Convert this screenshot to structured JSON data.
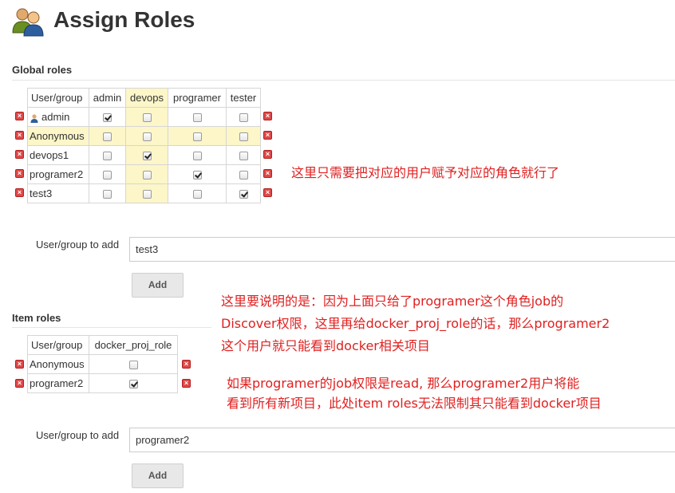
{
  "page": {
    "title": "Assign Roles"
  },
  "global_roles": {
    "header": "Global roles",
    "columns": [
      "User/group",
      "admin",
      "devops",
      "programer",
      "tester"
    ],
    "rows": [
      {
        "name": "admin",
        "has_user_icon": true,
        "checks": [
          true,
          false,
          false,
          false
        ]
      },
      {
        "name": "Anonymous",
        "has_user_icon": false,
        "checks": [
          false,
          false,
          false,
          false
        ]
      },
      {
        "name": "devops1",
        "has_user_icon": false,
        "checks": [
          false,
          true,
          false,
          false
        ]
      },
      {
        "name": "programer2",
        "has_user_icon": false,
        "checks": [
          false,
          false,
          true,
          false
        ]
      },
      {
        "name": "test3",
        "has_user_icon": false,
        "checks": [
          false,
          false,
          false,
          true
        ]
      }
    ],
    "add_label": "User/group to add",
    "add_value": "test3",
    "add_button": "Add"
  },
  "item_roles": {
    "header": "Item roles",
    "columns": [
      "User/group",
      "docker_proj_role"
    ],
    "rows": [
      {
        "name": "Anonymous",
        "checks": [
          false
        ]
      },
      {
        "name": "programer2",
        "checks": [
          true
        ]
      }
    ],
    "add_label": "User/group to add",
    "add_value": "programer2",
    "add_button": "Add"
  },
  "annotations": {
    "note1": "这里只需要把对应的用户赋予对应的角色就行了",
    "note2_lines": [
      "这里要说明的是：因为上面只给了programer这个角色job的",
      "Discover权限，这里再给docker_proj_role的话，那么programer2",
      "这个用户就只能看到docker相关项目"
    ],
    "note3_lines": [
      "如果programer的job权限是read, 那么programer2用户将能",
      "看到所有新项目，此处item roles无法限制其只能看到docker项目"
    ],
    "color": "#e02020"
  }
}
